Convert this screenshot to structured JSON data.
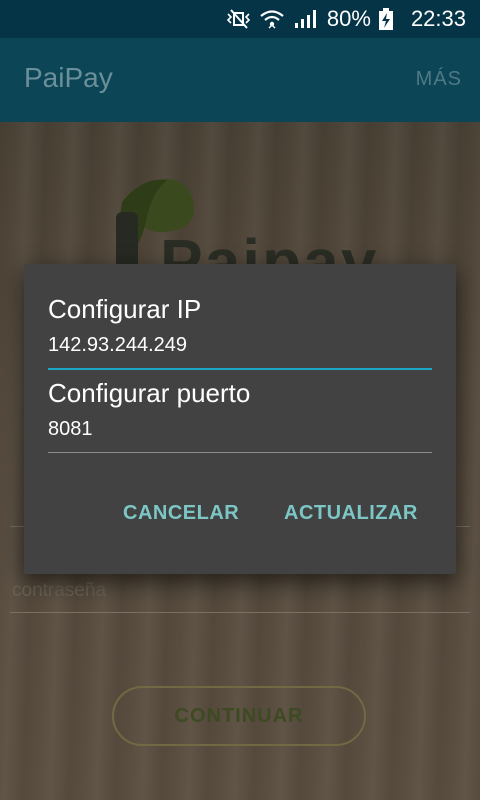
{
  "status_bar": {
    "battery_percent": "80%",
    "time": "22:33",
    "icons": [
      "mute-vibrate-icon",
      "wifi-icon",
      "signal-icon",
      "battery-charging-icon"
    ]
  },
  "app_bar": {
    "title": "PaiPay",
    "more_label": "MÁS"
  },
  "login": {
    "logo_text": "Paipay",
    "password_placeholder": "contraseña",
    "continue_label": "CONTINUAR"
  },
  "dialog": {
    "ip_label": "Configurar IP",
    "ip_value": "142.93.244.249",
    "port_label": "Configurar puerto",
    "port_value": "8081",
    "cancel_label": "CANCELAR",
    "update_label": "ACTUALIZAR"
  },
  "colors": {
    "status_bar": "#063447",
    "app_bar": "#0b4556",
    "dialog_bg": "#424242",
    "accent": "#1ea7c5",
    "button_text": "#7cc6c6"
  }
}
